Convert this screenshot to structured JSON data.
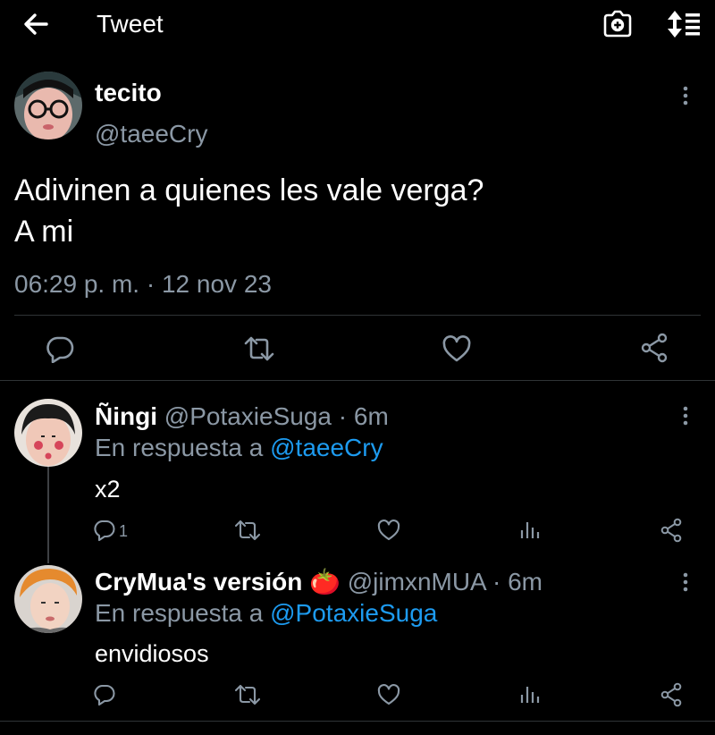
{
  "header": {
    "title": "Tweet"
  },
  "tweet": {
    "name": "tecito",
    "handle": "@taeeCry",
    "text_line1": "Adivinen a quienes les vale verga?",
    "text_line2": "A mi",
    "timestamp": "06:29 p. m. · 12 nov 23"
  },
  "replies": [
    {
      "name": "Ñingi",
      "handle": "@PotaxieSuga",
      "time": "· 6m",
      "reply_prefix": "En respuesta a",
      "reply_to": "@taeeCry",
      "text": "x2",
      "reply_count": "1"
    },
    {
      "name": "CryMua's versión",
      "emoji": "🍅",
      "handle": "@jimxnMUA",
      "time": "· 6m",
      "reply_prefix": "En respuesta a",
      "reply_to": "@PotaxieSuga",
      "text": "envidiosos",
      "reply_count": ""
    }
  ],
  "colors": {
    "background": "#000000",
    "muted": "#8b98a5",
    "accent": "#1d9bf0",
    "divider": "#2f3336"
  }
}
